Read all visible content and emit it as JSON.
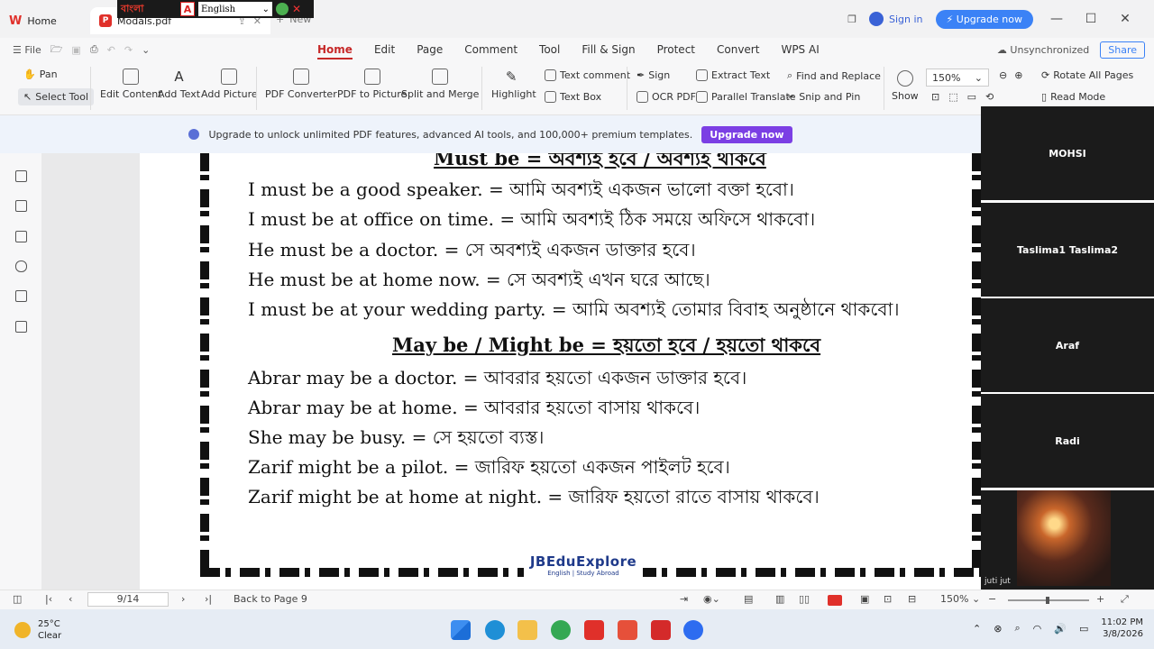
{
  "tabs": {
    "home": "Home",
    "active_doc": "Modals.pdf",
    "new_tab": "New"
  },
  "ime": {
    "bangla": "বাংলা",
    "a_icon": "A",
    "language": "English"
  },
  "title_right": {
    "sign_in": "Sign in",
    "upgrade": "Upgrade now"
  },
  "menu": {
    "file": "File",
    "tabs": [
      "Home",
      "Edit",
      "Page",
      "Comment",
      "Tool",
      "Fill & Sign",
      "Protect",
      "Convert",
      "WPS AI"
    ],
    "sync": "Unsynchronized",
    "share": "Share"
  },
  "ribbon": {
    "pan": "Pan",
    "select_tool": "Select Tool",
    "edit_content": "Edit Content",
    "add_text": "Add Text",
    "add_picture": "Add Picture",
    "pdf_converter": "PDF Converter",
    "pdf_to_picture": "PDF to Picture",
    "split_merge": "Split and Merge",
    "highlight": "Highlight",
    "text_comment": "Text comment",
    "text_box": "Text Box",
    "sign": "Sign",
    "ocr_pdf": "OCR PDF",
    "extract_text": "Extract Text",
    "parallel_translate": "Parallel Translate",
    "find_replace": "Find and Replace",
    "snip_pin": "Snip and Pin",
    "show": "Show",
    "zoom": "150%",
    "rotate_all": "Rotate All Pages",
    "read_mode": "Read Mode"
  },
  "banner": {
    "text": "Upgrade to unlock unlimited PDF features, advanced AI tools, and 100,000+ premium templates.",
    "button": "Upgrade now"
  },
  "document": {
    "heading_top": "Must be = অবশ্যই হবে / অবশ্যই থাকবে",
    "must_lines": [
      "I must be a good speaker. = আমি অবশ্যই একজন ভালো বক্তা হবো।",
      "I must be at office on time. = আমি অবশ্যই ঠিক সময়ে অফিসে থাকবো।",
      "He must be a doctor. = সে অবশ্যই একজন ডাক্তার হবে।",
      "He must be at home now. = সে অবশ্যই এখন ঘরে আছে।",
      "I must be at your wedding party. = আমি অবশ্যই তোমার বিবাহ অনুষ্ঠানে থাকবো।"
    ],
    "heading_may": "May be / Might be = হয়তো হবে / হয়তো থাকবে",
    "may_lines": [
      "Abrar may be a doctor. = আবরার হয়তো একজন ডাক্তার হবে।",
      "Abrar may be at home. = আবরার হয়তো বাসায় থাকবে।",
      "She may be busy. = সে হয়তো ব্যস্ত।",
      "Zarif might be a pilot. = জারিফ হয়তো একজন পাইলট হবে।",
      "Zarif might be at home at night. = জারিফ হয়তো রাতে বাসায় থাকবে।"
    ],
    "logo": "JBEduExplore",
    "logo_sub": "English | Study Abroad"
  },
  "participants": [
    "MOHSI",
    "Taslima1 Taslima2",
    "Araf",
    "Radi"
  ],
  "video_name": "juti jut",
  "status": {
    "page": "9/14",
    "back": "Back to Page 9",
    "zoom": "150%"
  },
  "taskbar": {
    "temp": "25°C",
    "condition": "Clear",
    "time": "11:02 PM",
    "date": "3/8/2026"
  },
  "colors": {
    "accent_red": "#c62828",
    "upgrade_blue": "#3b82f6",
    "banner_purple": "#7b3fe4"
  }
}
